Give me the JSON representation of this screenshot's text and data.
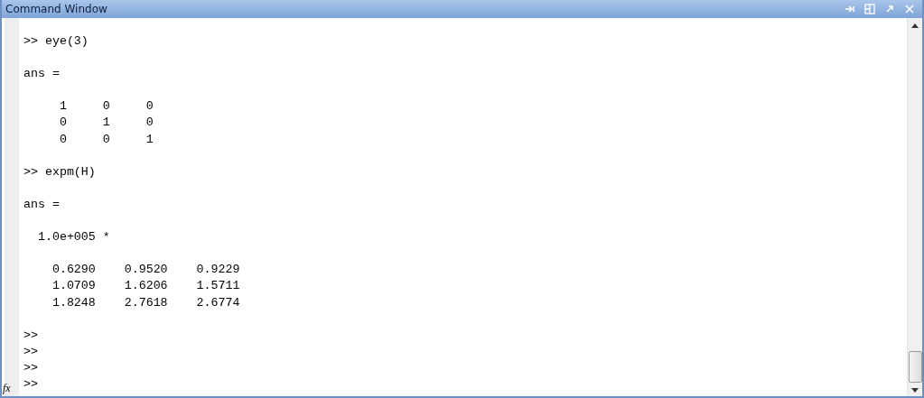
{
  "window": {
    "title": "Command Window"
  },
  "function_button": "fx",
  "blocks": [
    {
      "lines": [
        ">> eye(3)"
      ]
    },
    {
      "lines": [
        "ans ="
      ]
    },
    {
      "lines": [
        "     1     0     0",
        "     0     1     0",
        "     0     0     1"
      ]
    },
    {
      "lines": [
        ">> expm(H)"
      ]
    },
    {
      "lines": [
        "ans ="
      ]
    },
    {
      "lines": [
        "  1.0e+005 *"
      ]
    },
    {
      "lines": [
        "    0.6290    0.9520    0.9229",
        "    1.0709    1.6206    1.5711",
        "    1.8248    2.7618    2.6774"
      ]
    },
    {
      "lines": [
        ">>",
        ">>",
        ">>",
        ">>"
      ]
    }
  ]
}
